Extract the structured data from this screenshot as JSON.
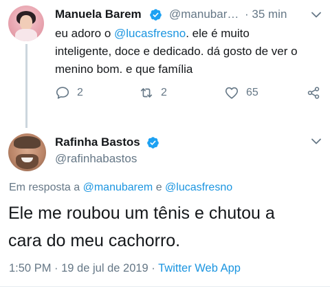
{
  "tweet1": {
    "name": "Manuela Barem",
    "handle": "@manubar…",
    "time": "· 35 min",
    "text": {
      "line1_pre": "eu adoro o ",
      "line1_mention": "@lucasfresno",
      "line1_post": ". ele é muito",
      "line2": "inteligente, doce e dedicado. dá gosto de ver o",
      "line3": "menino bom. e que família"
    },
    "actions": {
      "replies": "2",
      "retweets": "2",
      "likes": "65"
    }
  },
  "tweet2": {
    "name": "Rafinha Bastos",
    "handle": "@rafinhabastos",
    "reply_prefix": "Em resposta a",
    "reply_user1": "@manubarem",
    "reply_and": "e",
    "reply_user2": "@lucasfresno",
    "text_line1": "Ele me roubou um tênis e chutou a",
    "text_line2": "cara do meu cachorro.",
    "timestamp": "1:50 PM · 19 de jul de 2019 ·",
    "app": "Twitter Web App"
  },
  "colors": {
    "verified": "#1da1f2",
    "link": "#1b95e0",
    "secondary": "#657786",
    "primary_text": "#14171a"
  }
}
